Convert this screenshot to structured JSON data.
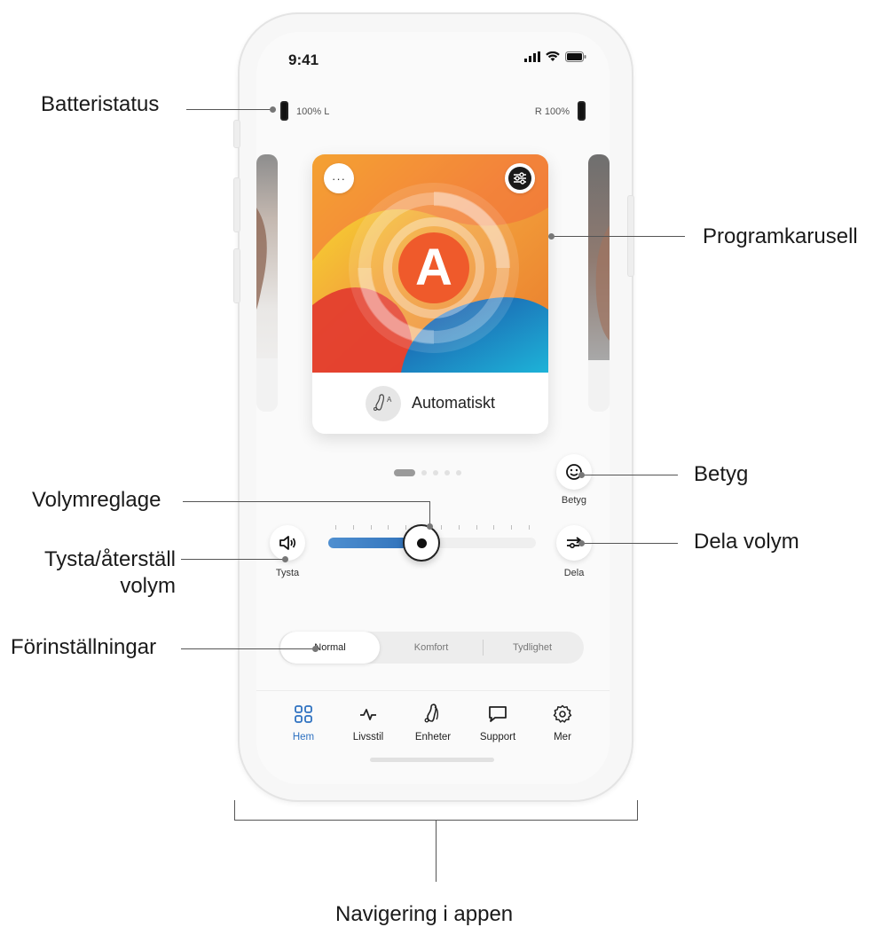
{
  "status_bar": {
    "time": "9:41"
  },
  "battery": {
    "left": "100% L",
    "right": "R  100%"
  },
  "program": {
    "letter": "A",
    "name": "Automatiskt",
    "more_label": "···"
  },
  "controls": {
    "mute_label": "Tysta",
    "rate_label": "Betyg",
    "share_label": "Dela",
    "volume_level": 0.45
  },
  "presets": [
    {
      "label": "Normal",
      "selected": true
    },
    {
      "label": "Komfort",
      "selected": false
    },
    {
      "label": "Tydlighet",
      "selected": false
    }
  ],
  "nav": [
    {
      "label": "Hem",
      "icon": "grid-icon",
      "active": true
    },
    {
      "label": "Livsstil",
      "icon": "activity-icon",
      "active": false
    },
    {
      "label": "Enheter",
      "icon": "hearing-aid-icon",
      "active": false
    },
    {
      "label": "Support",
      "icon": "chat-icon",
      "active": false
    },
    {
      "label": "Mer",
      "icon": "gear-icon",
      "active": false
    }
  ],
  "callouts": {
    "battery_status": "Batteristatus",
    "program_carousel": "Programkarusell",
    "rating": "Betyg",
    "volume_slider": "Volymreglage",
    "share_volume": "Dela volym",
    "mute_reset_line1": "Tysta/återställ",
    "mute_reset_line2": "volym",
    "presets": "Förinställningar",
    "app_navigation": "Navigering i appen"
  },
  "colors": {
    "accent": "#2f72c1",
    "volume_fill": "#3f80c6"
  }
}
